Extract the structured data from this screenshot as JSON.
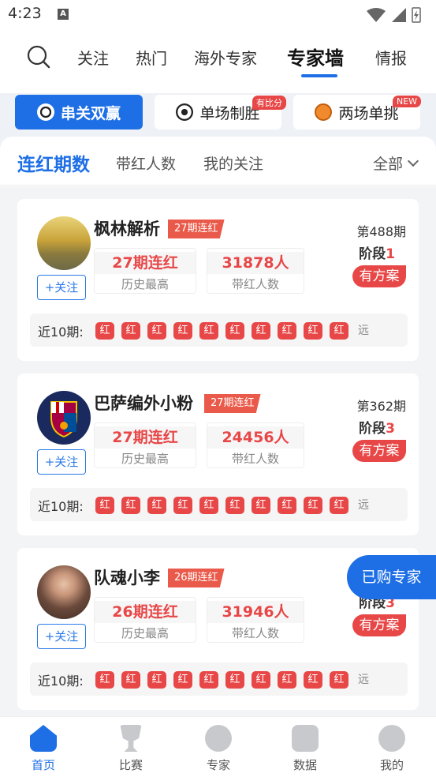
{
  "status_bar": {
    "time": "4:23"
  },
  "top_tabs": [
    "关注",
    "热门",
    "海外专家",
    "专家墙",
    "情报"
  ],
  "segments": [
    {
      "label": "串关双赢",
      "badge": ""
    },
    {
      "label": "单场制胜",
      "badge": "有比分"
    },
    {
      "label": "两场单挑",
      "badge": "NEW"
    }
  ],
  "sub_tabs": [
    "连红期数",
    "带红人数",
    "我的关注"
  ],
  "filter_label": "全部",
  "follow_label": "+关注",
  "recent_label": "近10期:",
  "dot_label": "红",
  "far_label": "远",
  "plan_label": "有方案",
  "stat_labels": {
    "max": "历史最高",
    "fans": "带红人数"
  },
  "stage_prefix": "阶段",
  "experts": [
    {
      "name": "枫林解析",
      "badge": "27期连红",
      "max": "27期连红",
      "fans": "31878人",
      "period": "第488期",
      "stage": "1",
      "avatar_color": "#b89b3a"
    },
    {
      "name": "巴萨编外小粉",
      "badge": "27期连红",
      "max": "27期连红",
      "fans": "24456人",
      "period": "第362期",
      "stage": "3",
      "avatar_color": "#1a2a5e"
    },
    {
      "name": "队魂小李",
      "badge": "26期连红",
      "max": "26期连红",
      "fans": "31946人",
      "period": "",
      "stage": "3",
      "avatar_color": "#7a5a46"
    }
  ],
  "floating_button": "已购专家",
  "bottom_nav": [
    "首页",
    "比赛",
    "专家",
    "数据",
    "我的"
  ]
}
